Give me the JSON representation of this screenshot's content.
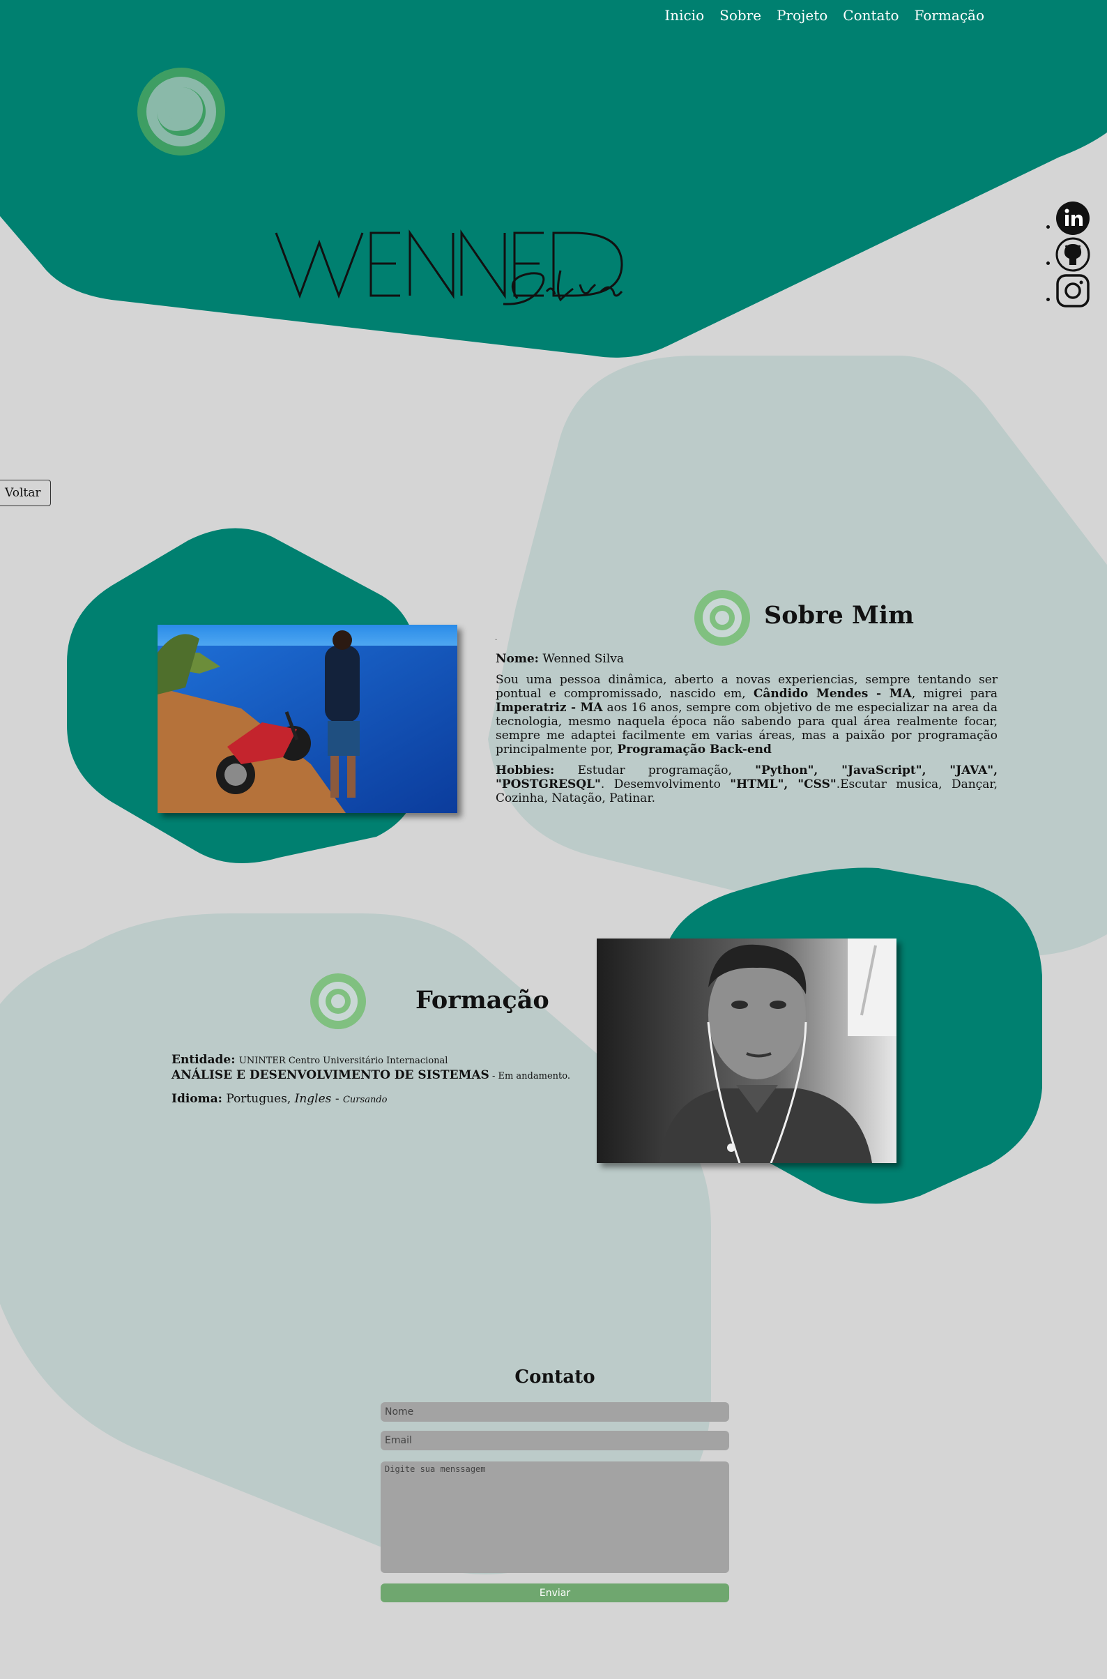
{
  "nav": {
    "items": [
      "Inicio",
      "Sobre",
      "Projeto",
      "Contato",
      "Formação"
    ]
  },
  "header": {
    "wordmark_main": "WENNED",
    "wordmark_script": "Silva"
  },
  "social": {
    "icons": [
      "linkedin-icon",
      "github-icon",
      "instagram-icon"
    ]
  },
  "back_button": "Voltar",
  "about": {
    "dot": ".",
    "title": "Sobre Mim",
    "name_label": "Nome:",
    "name_value": "Wenned Silva",
    "bio_1": "Sou uma pessoa dinâmica, aberto a novas experiencias, sempre tentando ser pontual e compromissado, nascido em, ",
    "bio_city1": "Cândido Mendes - MA",
    "bio_2": ", migrei para ",
    "bio_city2": "Imperatriz - MA",
    "bio_3": " aos 16 anos, sempre com objetivo de me especializar na area da tecnologia, mesmo naquela época não sabendo para qual área realmente focar, sempre me adaptei facilmente em varias áreas, mas a paixão por programação principalmente por, ",
    "bio_focus": "Programação Back-end",
    "hobbies_label": "Hobbies:",
    "hobbies_1": " Estudar programação, ",
    "hobbies_langs": "\"Python\", \"JavaScript\", \"JAVA\", \"POSTGRESQL\"",
    "hobbies_2": ". Desemvolvimento ",
    "hobbies_web": "\"HTML\", \"CSS\"",
    "hobbies_3": ".Escutar musica, Dançar, Cozinha, Natação, Patinar."
  },
  "formacao": {
    "title": "Formação",
    "entity_label": "Entidade:",
    "entity_value": "UNINTER Centro Universitário Internacional",
    "course": "ANÁLISE E DESENVOLVIMENTO DE SISTEMAS",
    "course_status": " - Em andamento.",
    "lang_label": "Idioma:",
    "lang_1": " Portugues, ",
    "lang_2": "Ingles",
    "lang_3": " - ",
    "lang_status": "Cursando"
  },
  "contato": {
    "title": "Contato",
    "name_placeholder": "Nome",
    "email_placeholder": "Email",
    "message_placeholder": "Digite sua menssagem",
    "send_label": "Enviar"
  },
  "colors": {
    "primary": "#008070",
    "light_blob": "#bccbc9",
    "accent": "#6fa76f",
    "background": "#d5d5d5"
  }
}
